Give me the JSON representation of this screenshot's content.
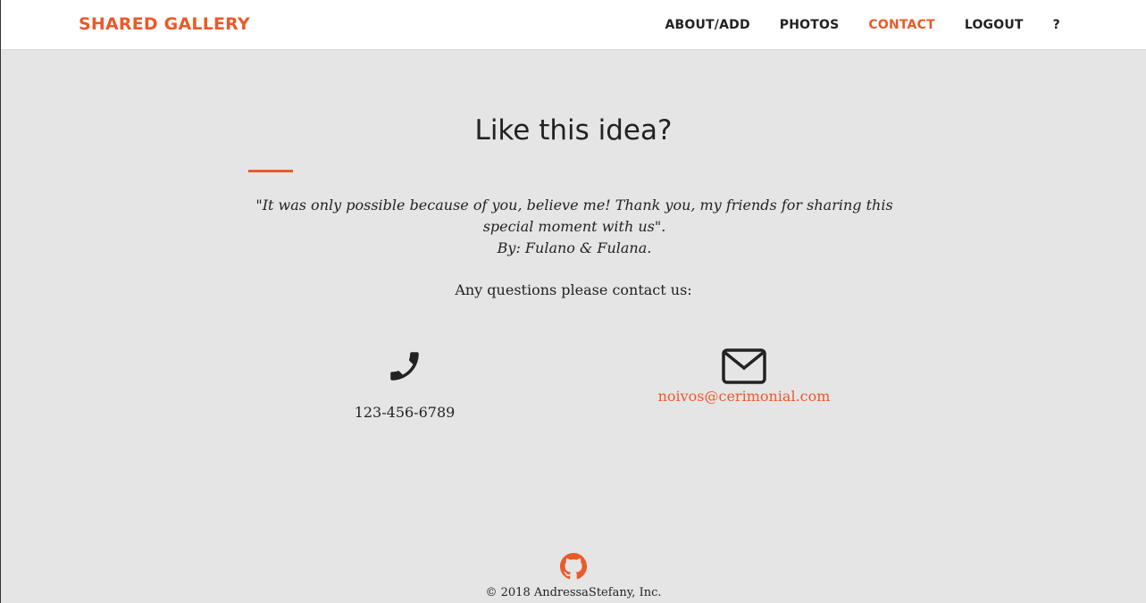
{
  "nav": {
    "brand": "SHARED GALLERY",
    "links": [
      {
        "label": "ABOUT/ADD",
        "active": false
      },
      {
        "label": "PHOTOS",
        "active": false
      },
      {
        "label": "CONTACT",
        "active": true
      },
      {
        "label": "LOGOUT",
        "active": false
      },
      {
        "label": "?",
        "active": false
      }
    ]
  },
  "main": {
    "heading": "Like this idea?",
    "quote_line1": "\"It was only possible because of you, believe me! Thank you, my friends for sharing this special moment with us\".",
    "quote_line2": "By: Fulano & Fulana.",
    "contact_intro": "Any questions please contact us:",
    "phone": {
      "icon": "phone-icon",
      "value": "123-456-6789"
    },
    "email": {
      "icon": "envelope-icon",
      "value": "noivos@cerimonial.com"
    }
  },
  "footer": {
    "icon": "github-icon",
    "copyright": "© 2018 AndressaStefany, Inc."
  },
  "colors": {
    "accent": "#eb5a28",
    "background": "#e5e5e5",
    "navbar": "#ffffff",
    "text": "#222222"
  }
}
